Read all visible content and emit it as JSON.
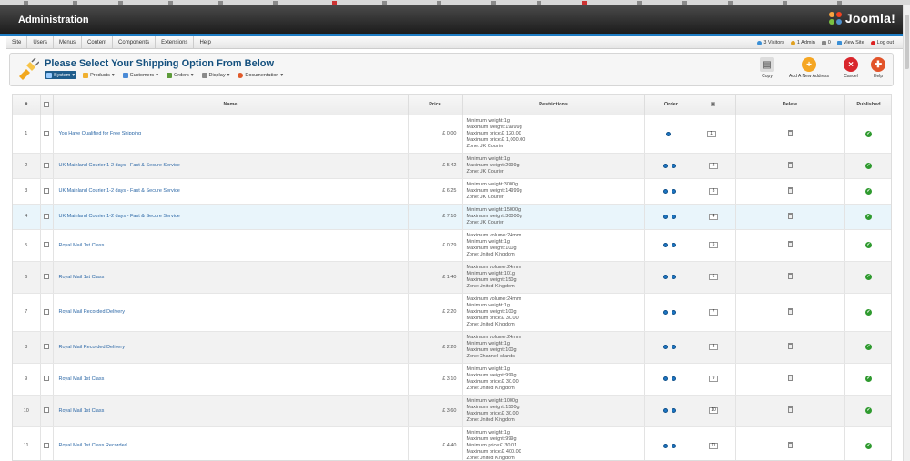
{
  "header": {
    "title": "Administration",
    "logo_text": "Joomla!"
  },
  "menu": [
    "Site",
    "Users",
    "Menus",
    "Content",
    "Components",
    "Extensions",
    "Help"
  ],
  "status": {
    "visitors": "3 Visitors",
    "admins": "1 Admin",
    "messages": "0",
    "view_site": "View Site",
    "logout": "Log out"
  },
  "page": {
    "title": "Please Select Your Shipping Option From Below"
  },
  "submenu": [
    {
      "label": "System",
      "active": true
    },
    {
      "label": "Products"
    },
    {
      "label": "Customers"
    },
    {
      "label": "Orders"
    },
    {
      "label": "Display"
    },
    {
      "label": "Documentation"
    }
  ],
  "toolbar": {
    "copy": "Copy",
    "add": "Add A New Address",
    "cancel": "Cancel",
    "help": "Help"
  },
  "table": {
    "headers": {
      "num": "#",
      "name": "Name",
      "price": "Price",
      "restrictions": "Restrictions",
      "order": "Order",
      "delete": "Delete",
      "published": "Published"
    },
    "rows": [
      {
        "num": "1",
        "name": "You Have Qualified for Free Shipping",
        "price": "£ 0.00",
        "restrictions": [
          "Minimum weight:1g",
          "Maximum weight:19999g",
          "Maximum price:£ 120.00",
          "Maximum price:£ 1,000.00",
          "Zone:UK Courier"
        ],
        "arrows": 1,
        "order": "1"
      },
      {
        "num": "2",
        "name": "UK Mainland Courier 1-2 days - Fast & Secure Service",
        "price": "£ 5.42",
        "restrictions": [
          "Minimum weight:1g",
          "Maximum weight:2999g",
          "Zone:UK Courier"
        ],
        "arrows": 2,
        "order": "2"
      },
      {
        "num": "3",
        "name": "UK Mainland Courier 1-2 days - Fast & Secure Service",
        "price": "£ 6.25",
        "restrictions": [
          "Minimum weight:3000g",
          "Maximum weight:14999g",
          "Zone:UK Courier"
        ],
        "arrows": 2,
        "order": "3"
      },
      {
        "num": "4",
        "name": "UK Mainland Courier 1-2 days - Fast & Secure Service",
        "price": "£ 7.10",
        "restrictions": [
          "Minimum weight:15000g",
          "Maximum weight:30000g",
          "Zone:UK Courier"
        ],
        "arrows": 2,
        "order": "4",
        "highlight": true
      },
      {
        "num": "5",
        "name": "Royal Mail 1st Class",
        "price": "£ 0.79",
        "restrictions": [
          "Maximum volume:24mm",
          "Minimum weight:1g",
          "Maximum weight:100g",
          "Zone:United Kingdom"
        ],
        "arrows": 2,
        "order": "5"
      },
      {
        "num": "6",
        "name": "Royal Mail 1st Class",
        "price": "£ 1.40",
        "restrictions": [
          "Maximum volume:24mm",
          "Minimum weight:101g",
          "Maximum weight:150g",
          "Zone:United Kingdom"
        ],
        "arrows": 2,
        "order": "6"
      },
      {
        "num": "7",
        "name": "Royal Mail Recorded Delivery",
        "price": "£ 2.20",
        "restrictions": [
          "Maximum volume:24mm",
          "Minimum weight:1g",
          "Maximum weight:100g",
          "Maximum price:£ 30.00",
          "Zone:United Kingdom"
        ],
        "arrows": 2,
        "order": "7"
      },
      {
        "num": "8",
        "name": "Royal Mail Recorded Delivery",
        "price": "£ 2.20",
        "restrictions": [
          "Maximum volume:24mm",
          "Minimum weight:1g",
          "Maximum weight:100g",
          "Zone:Channel Islands"
        ],
        "arrows": 2,
        "order": "8"
      },
      {
        "num": "9",
        "name": "Royal Mail 1st Class",
        "price": "£ 3.10",
        "restrictions": [
          "Minimum weight:1g",
          "Maximum weight:999g",
          "Maximum price:£ 30.00",
          "Zone:United Kingdom"
        ],
        "arrows": 2,
        "order": "9"
      },
      {
        "num": "10",
        "name": "Royal Mail 1st Class",
        "price": "£ 3.60",
        "restrictions": [
          "Minimum weight:1000g",
          "Maximum weight:1500g",
          "Maximum price:£ 30.00",
          "Zone:United Kingdom"
        ],
        "arrows": 2,
        "order": "10"
      },
      {
        "num": "11",
        "name": "Royal Mail 1st Class Recorded",
        "price": "£ 4.40",
        "restrictions": [
          "Minimum weight:1g",
          "Maximum weight:999g",
          "Minimum price:£ 30.01",
          "Maximum price:£ 400.00",
          "Zone:United Kingdom"
        ],
        "arrows": 2,
        "order": "11"
      }
    ]
  }
}
